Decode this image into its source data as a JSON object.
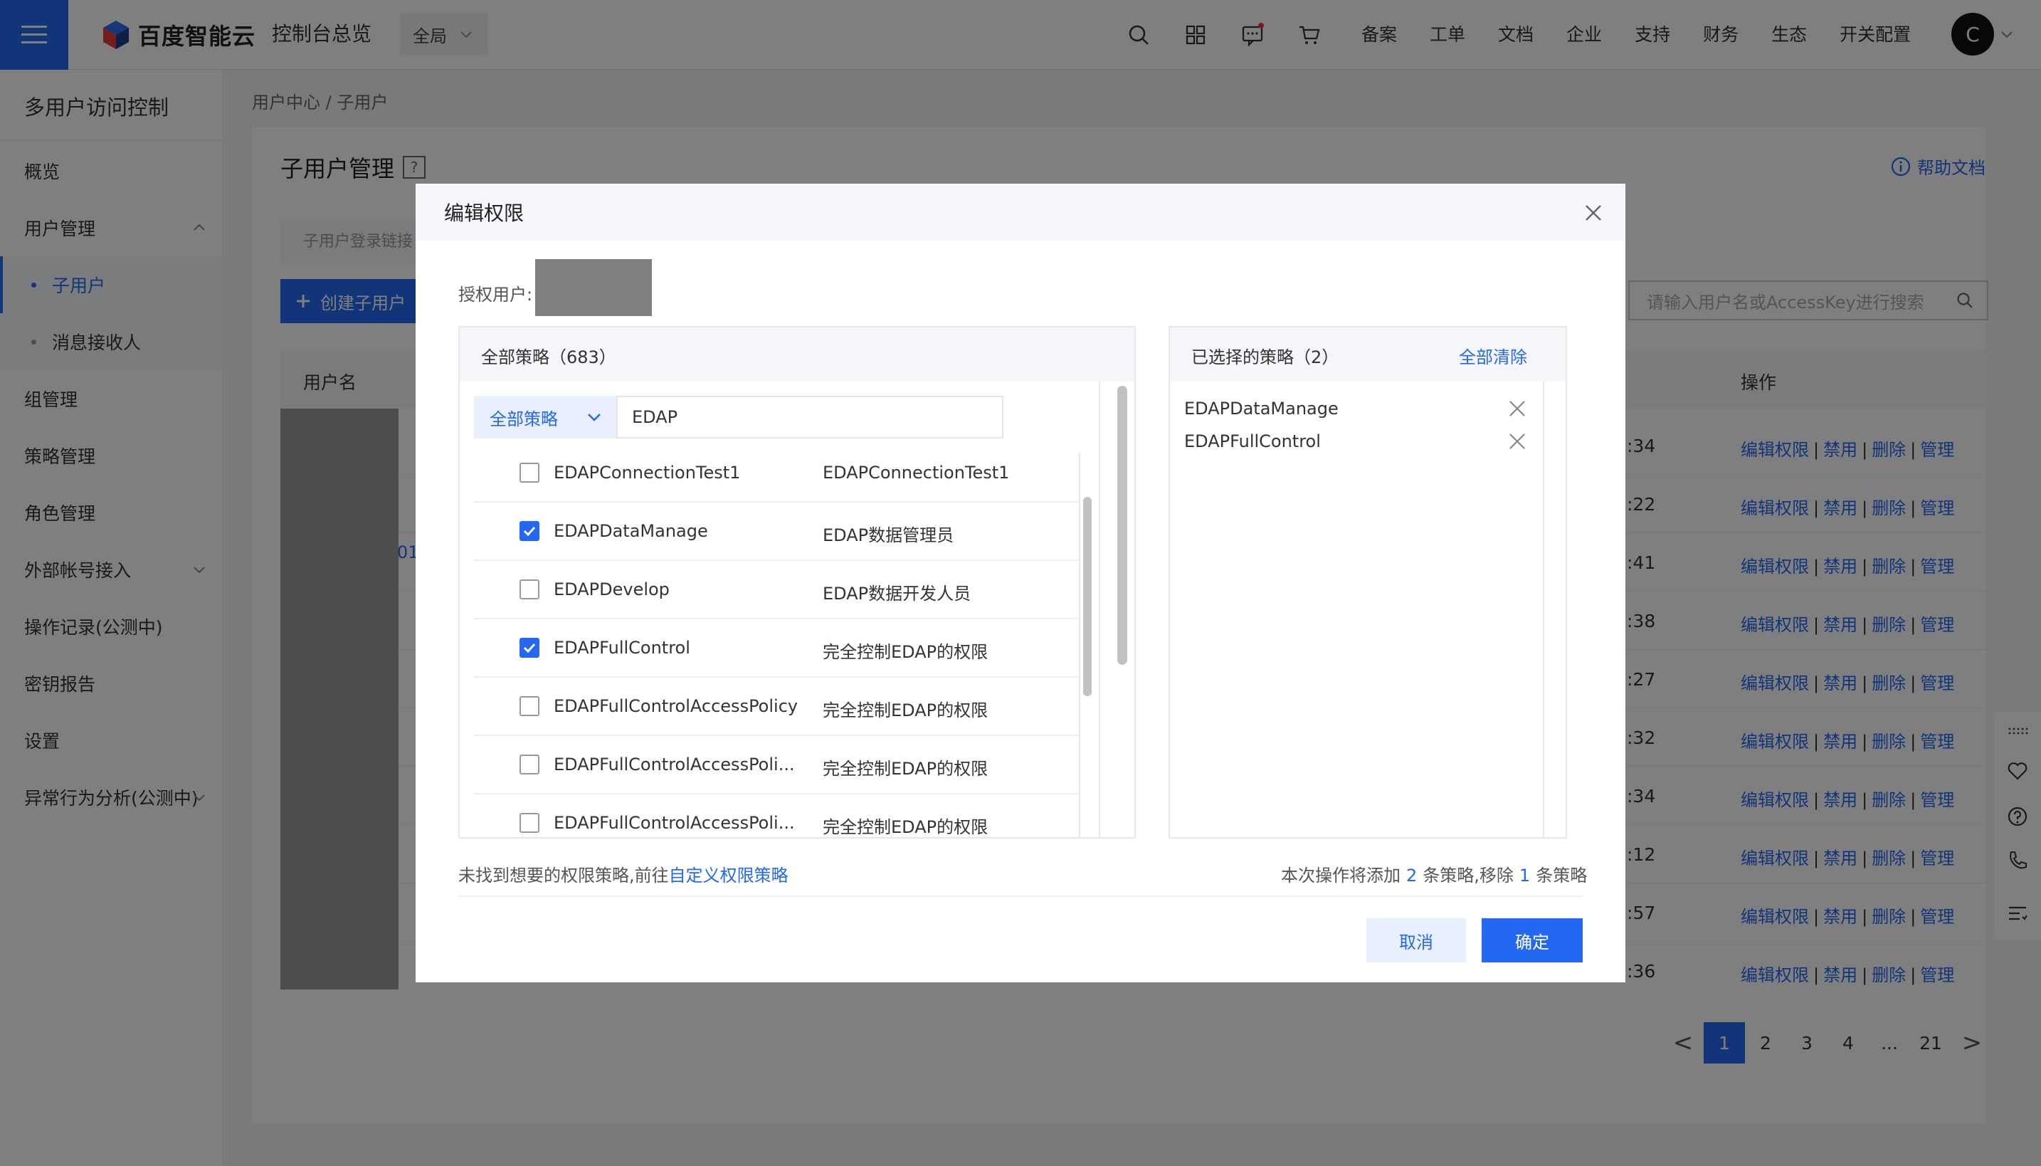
{
  "topbar": {
    "logo_text": "百度智能云",
    "console_title": "控制台总览",
    "region": "全局",
    "nav": [
      "备案",
      "工单",
      "文档",
      "企业",
      "支持",
      "财务",
      "生态",
      "开关配置"
    ],
    "avatar_letter": "C"
  },
  "sidebar": {
    "title": "多用户访问控制",
    "items": [
      {
        "label": "概览"
      },
      {
        "label": "用户管理"
      },
      {
        "label": "子用户"
      },
      {
        "label": "消息接收人"
      },
      {
        "label": "组管理"
      },
      {
        "label": "策略管理"
      },
      {
        "label": "角色管理"
      },
      {
        "label": "外部帐号接入"
      },
      {
        "label": "操作记录(公测中)"
      },
      {
        "label": "密钥报告"
      },
      {
        "label": "设置"
      },
      {
        "label": "异常行为分析(公测中)"
      }
    ]
  },
  "page": {
    "breadcrumb": "用户中心 /  子用户",
    "title": "子用户管理",
    "title_help": "?",
    "help_doc": "帮助文档",
    "login_link_label": "子用户登录链接",
    "create_button": "创建子用户",
    "search_placeholder": "请输入用户名或AccessKey进行搜索",
    "col_user": "用户名",
    "col_ops": "操作",
    "partial_link": "01",
    "rows": [
      {
        "time": ":34"
      },
      {
        "time": ":22"
      },
      {
        "time": ":41"
      },
      {
        "time": ":38"
      },
      {
        "time": ":27"
      },
      {
        "time": ":32"
      },
      {
        "time": ":34"
      },
      {
        "time": ":12"
      },
      {
        "time": ":57"
      },
      {
        "time": ":36"
      }
    ],
    "ops": {
      "edit": "编辑权限",
      "disable": "禁用",
      "delete": "删除",
      "manage": "管理",
      "sep": "|"
    }
  },
  "pagination": {
    "prev": "<",
    "pages": [
      "1",
      "2",
      "3",
      "4",
      "...",
      "21"
    ],
    "next": ">",
    "current": "1"
  },
  "modal": {
    "title": "编辑权限",
    "auth_user_label": "授权用户:",
    "left": {
      "header": "全部策略（683）",
      "filter_type": "全部策略",
      "filter_value": "EDAP",
      "policies": [
        {
          "name": "EDAPConnectionTest1",
          "desc": "EDAPConnectionTest1",
          "checked": false
        },
        {
          "name": "EDAPDataManage",
          "desc": "EDAP数据管理员",
          "checked": true
        },
        {
          "name": "EDAPDevelop",
          "desc": "EDAP数据开发人员",
          "checked": false
        },
        {
          "name": "EDAPFullControl",
          "desc": "完全控制EDAP的权限",
          "checked": true
        },
        {
          "name": "EDAPFullControlAccessPolicy",
          "desc": "完全控制EDAP的权限",
          "checked": false
        },
        {
          "name": "EDAPFullControlAccessPoli...",
          "desc": "完全控制EDAP的权限",
          "checked": false
        },
        {
          "name": "EDAPFullControlAccessPoli...",
          "desc": "完全控制EDAP的权限",
          "checked": false
        }
      ]
    },
    "right": {
      "header": "已选择的策略（2）",
      "clear_all": "全部清除",
      "selected": [
        "EDAPDataManage",
        "EDAPFullControl"
      ]
    },
    "not_found_text": "未找到想要的权限策略,前往",
    "custom_policy_link": "自定义权限策略",
    "summary_prefix": "本次操作将添加",
    "summary_add": "2",
    "summary_mid": "条策略,移除",
    "summary_remove": "1",
    "summary_suffix": "条策略",
    "cancel": "取消",
    "confirm": "确定"
  },
  "colors": {
    "primary": "#2468f2",
    "overlay": "rgba(0,0,0,0.5)"
  }
}
